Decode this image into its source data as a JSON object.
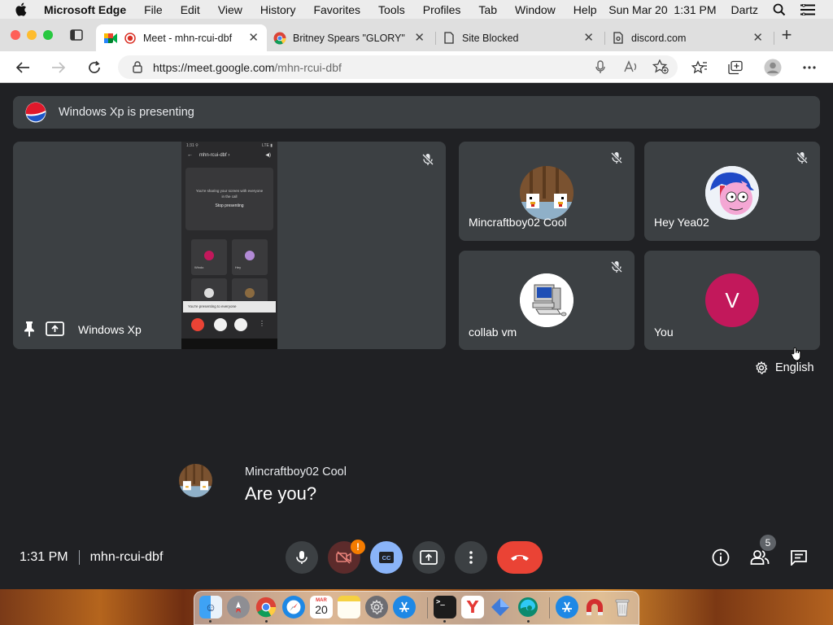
{
  "menubar": {
    "app_name": "Microsoft Edge",
    "items": [
      "File",
      "Edit",
      "View",
      "History",
      "Favorites",
      "Tools",
      "Profiles",
      "Tab",
      "Window",
      "Help"
    ],
    "clock": "Sun Mar 20  1:31 PM",
    "user": "Dartz"
  },
  "tabs": [
    {
      "title": "Meet - mhn-rcui-dbf",
      "icon": "google-meet-icon",
      "active": true,
      "recording": true
    },
    {
      "title": "Britney Spears \"GLORY\"",
      "icon": "chrome-icon",
      "active": false
    },
    {
      "title": "Site Blocked",
      "icon": "document-icon",
      "active": false
    },
    {
      "title": "discord.com",
      "icon": "discord-page-icon",
      "active": false
    }
  ],
  "toolbar": {
    "url_host": "https://meet.google.com",
    "url_path": "/mhn-rcui-dbf"
  },
  "meet": {
    "presenting_text": "Windows Xp is presenting",
    "presenter_tile": {
      "name": "Windows Xp",
      "phone": {
        "status_left": "1:31  ⚲",
        "status_right": "LTE ▮",
        "header": "mhn-rcui-dbf ›",
        "notice_line1": "You're sharing your screen with everyone",
        "notice_line2": "in the call",
        "stop_button": "Stop presenting",
        "tile_a": "Windo",
        "tile_b": "Hey",
        "toast": "You're presenting to everyone"
      }
    },
    "participants": [
      {
        "name": "Mincraftboy02 Cool",
        "muted": true,
        "avatar": "minecraft-chickens"
      },
      {
        "name": "Hey Yea02",
        "muted": true,
        "avatar": "cartoon-character"
      },
      {
        "name": "collab vm",
        "muted": true,
        "avatar": "computer"
      },
      {
        "name": "You",
        "muted": false,
        "avatar_letter": "V",
        "avatar_color": "#c2185b"
      }
    ],
    "caption_language": "English",
    "caption": {
      "speaker": "Mincraftboy02 Cool",
      "text": "Are you?"
    },
    "bottom": {
      "time": "1:31 PM",
      "meeting_code": "mhn-rcui-dbf",
      "people_count": "5",
      "camera_alert": "!"
    }
  },
  "dock": {
    "calendar_month": "MAR",
    "calendar_day": "20"
  },
  "colors": {
    "meet_bg": "#202124",
    "tile_bg": "#3c4043",
    "end_call": "#ea4335",
    "captions_active": "#8ab4f8",
    "camera_off": "#5c2b2b",
    "alert": "#f57c00"
  }
}
